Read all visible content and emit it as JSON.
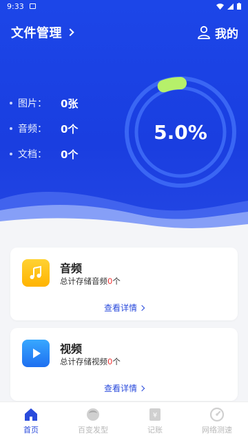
{
  "status": {
    "time": "9:33"
  },
  "header": {
    "title": "文件管理",
    "mine_label": "我的"
  },
  "stats": [
    {
      "label": "图片：",
      "value": "0张"
    },
    {
      "label": "音频：",
      "value": "0个"
    },
    {
      "label": "文档：",
      "value": "0个"
    }
  ],
  "gauge": {
    "percent_label": "5.0%",
    "fraction": 0.05
  },
  "cards": [
    {
      "name": "音频",
      "sub_prefix": "总计存储音频",
      "count": "0",
      "sub_suffix": "个",
      "detail": "查看详情"
    },
    {
      "name": "视频",
      "sub_prefix": "总计存储视频",
      "count": "0",
      "sub_suffix": "个",
      "detail": "查看详情"
    }
  ],
  "tabs": [
    {
      "label": "首页",
      "active": true
    },
    {
      "label": "百变发型",
      "active": false
    },
    {
      "label": "记账",
      "active": false
    },
    {
      "label": "网络测速",
      "active": false
    }
  ],
  "colors": {
    "primary": "#1c46e8",
    "accent_green": "#b6f06a",
    "tab_active": "#2a4bdc",
    "count_red": "#e33"
  }
}
